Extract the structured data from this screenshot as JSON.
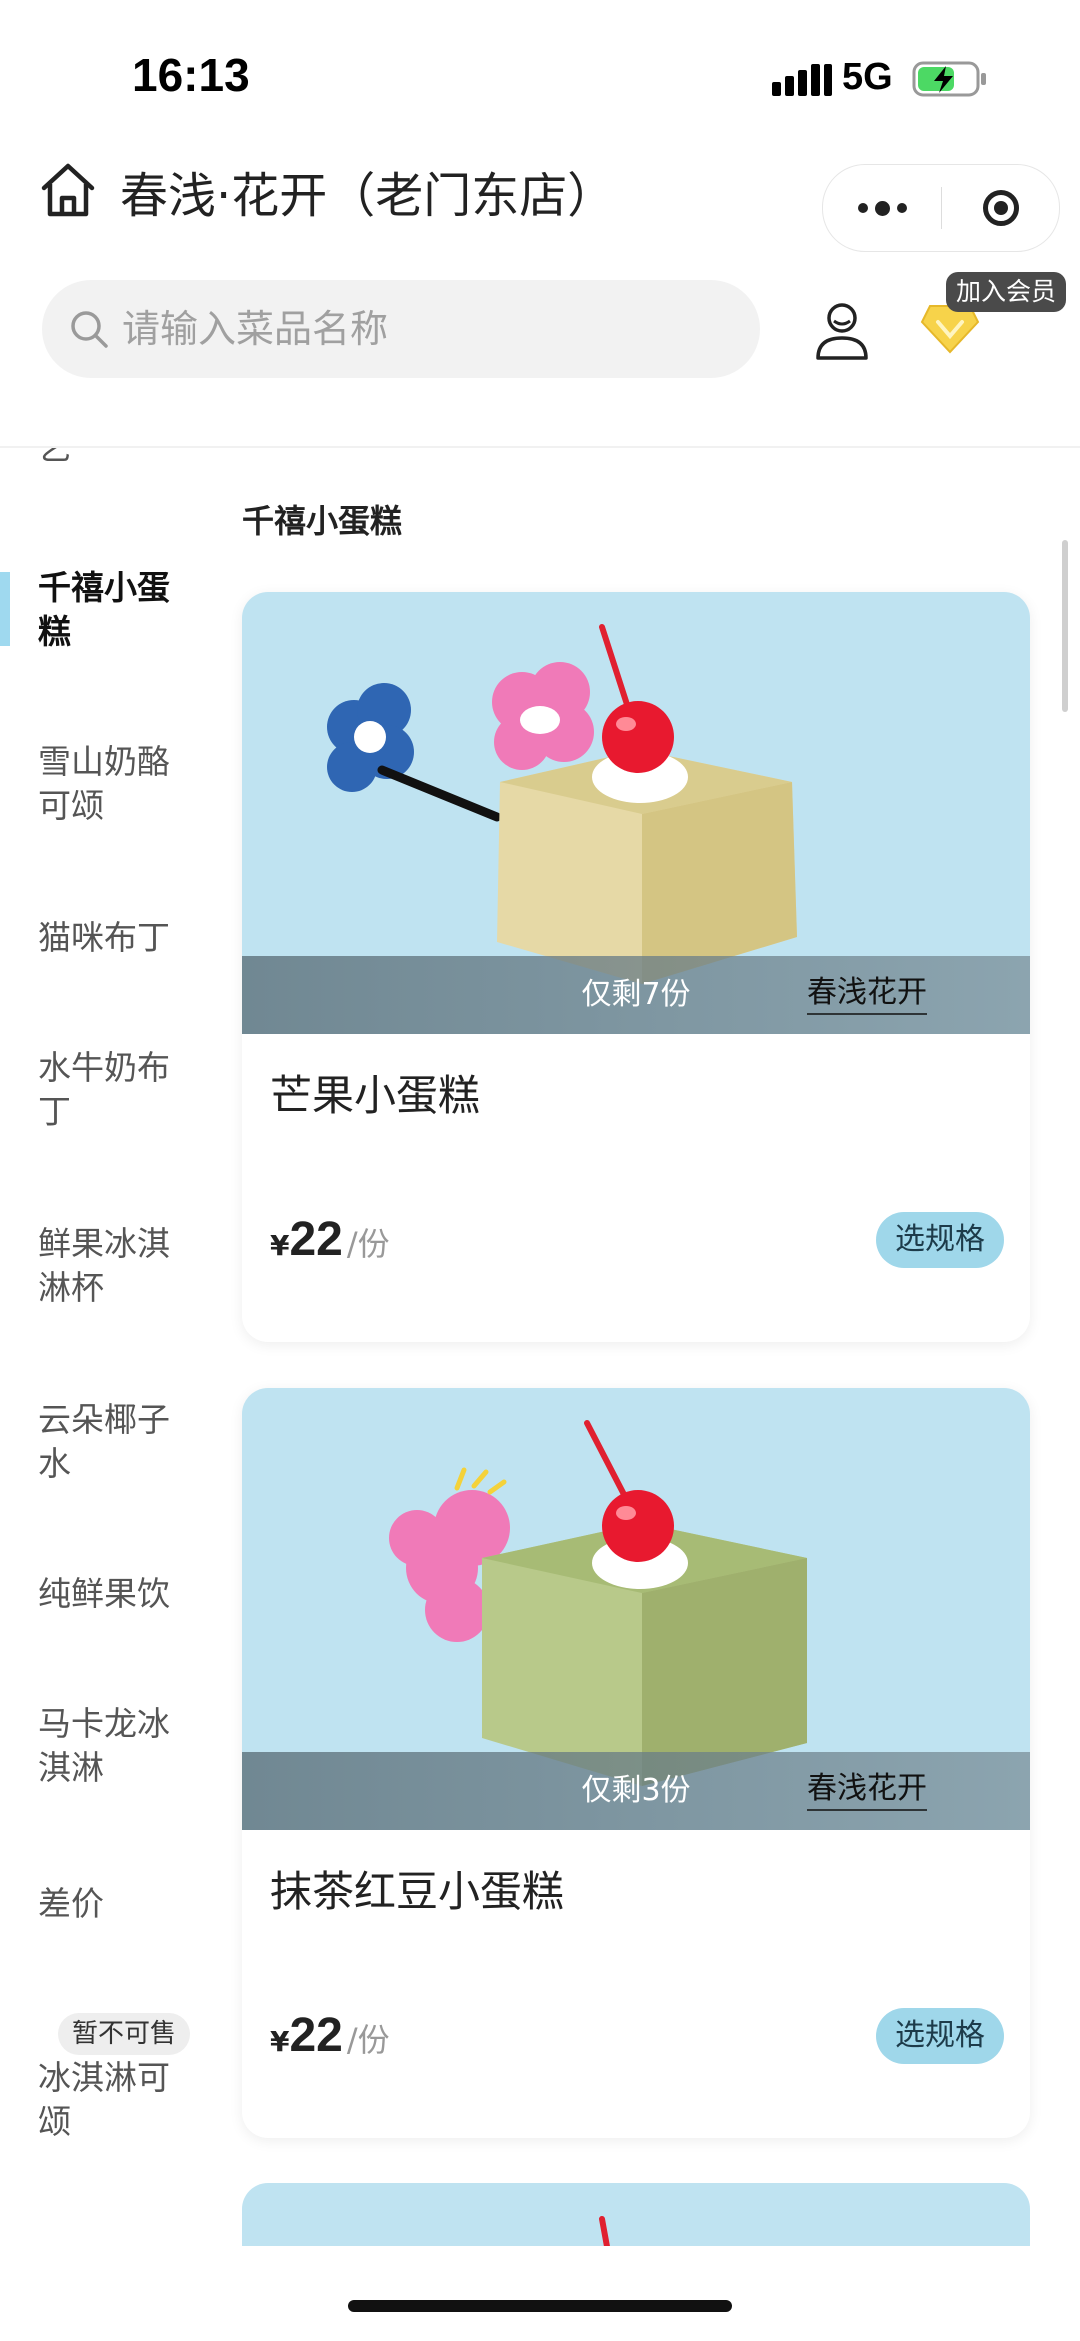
{
  "status_bar": {
    "time": "16:13",
    "network": "5G"
  },
  "nav": {
    "title": "春浅·花开（老门东店）"
  },
  "search": {
    "placeholder": "请输入菜品名称"
  },
  "member": {
    "tip": "加入会员"
  },
  "sidebar": {
    "items": [
      {
        "label": "乞"
      },
      {
        "label": "千禧小蛋糕",
        "active": true
      },
      {
        "label": "雪山奶酪可颂"
      },
      {
        "label": "猫咪布丁"
      },
      {
        "label": "水牛奶布丁"
      },
      {
        "label": "鲜果冰淇淋杯"
      },
      {
        "label": "云朵椰子水"
      },
      {
        "label": "纯鲜果饮"
      },
      {
        "label": "马卡龙冰淇淋"
      },
      {
        "label": "差价"
      },
      {
        "label": "冰淇淋可颂",
        "tag": "暂不可售"
      }
    ]
  },
  "section": {
    "title": "千禧小蛋糕"
  },
  "products": [
    {
      "name": "芒果小蛋糕",
      "stock": "仅剩7份",
      "currency": "¥",
      "price": "22",
      "unit": "/份",
      "button": "选规格",
      "watermark": "春浅花开",
      "cake_color": "#e6d9a6"
    },
    {
      "name": "抹茶红豆小蛋糕",
      "stock": "仅剩3份",
      "currency": "¥",
      "price": "22",
      "unit": "/份",
      "button": "选规格",
      "watermark": "春浅花开",
      "cake_color": "#b8c98a"
    }
  ],
  "colors": {
    "accent": "#9fd7ea",
    "image_bg": "#bfe3f1",
    "active_indicator": "#9fd9ef"
  }
}
